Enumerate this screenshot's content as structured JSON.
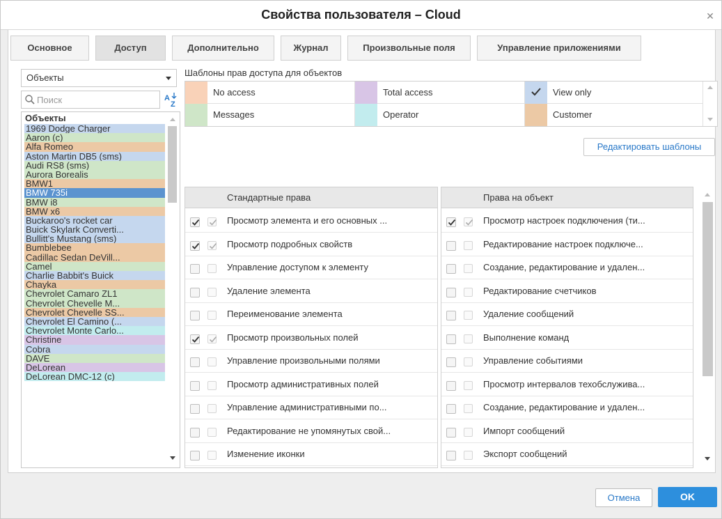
{
  "window": {
    "title": "Свойства пользователя – Cloud"
  },
  "tabs": [
    {
      "label": "Основное",
      "active": false
    },
    {
      "label": "Доступ",
      "active": true
    },
    {
      "label": "Дополнительно",
      "active": false
    },
    {
      "label": "Журнал",
      "active": false
    },
    {
      "label": "Произвольные поля",
      "active": false
    },
    {
      "label": "Управление приложениями",
      "active": false
    }
  ],
  "left_panel": {
    "object_type_select": "Объекты",
    "search_placeholder": "Поиск",
    "list_header": "Объекты",
    "items": [
      {
        "label": "1969 Dodge Charger",
        "color": "#c5d7ee"
      },
      {
        "label": "Aaron (c)",
        "color": "#cfe6c8"
      },
      {
        "label": "Alfa Romeo",
        "color": "#ecc9a5"
      },
      {
        "label": "Aston Martin DB5 (sms)",
        "color": "#c5d7ee"
      },
      {
        "label": "Audi RS8 (sms)",
        "color": "#cfe6c8"
      },
      {
        "label": "Aurora Borealis",
        "color": "#cfe6c8"
      },
      {
        "label": "BMW1",
        "color": "#ecc9a5"
      },
      {
        "label": "BMW 735i",
        "color": "#5b93cf",
        "selected": true
      },
      {
        "label": "BMW i8",
        "color": "#cfe6c8"
      },
      {
        "label": "BMW x6",
        "color": "#ecc9a5"
      },
      {
        "label": "Buckaroo's rocket car",
        "color": "#c5d7ee"
      },
      {
        "label": "Buick Skylark Converti...",
        "color": "#c5d7ee"
      },
      {
        "label": "Bullitt's Mustang (sms)",
        "color": "#c5d7ee"
      },
      {
        "label": "Bumblebee",
        "color": "#ecc9a5"
      },
      {
        "label": "Cadillac Sedan DeVill...",
        "color": "#ecc9a5"
      },
      {
        "label": "Camel",
        "color": "#cfe6c8"
      },
      {
        "label": "Charlie Babbit's Buick",
        "color": "#c5d7ee"
      },
      {
        "label": "Chayka",
        "color": "#ecc9a5"
      },
      {
        "label": "Chevrolet Camaro ZL1",
        "color": "#cfe6c8"
      },
      {
        "label": "Chevrolet Chevelle M...",
        "color": "#cfe6c8"
      },
      {
        "label": "Chevrolet Chevelle SS...",
        "color": "#ecc9a5"
      },
      {
        "label": "Chevrolet El Camino (...",
        "color": "#c5d7ee"
      },
      {
        "label": "Chevrolet Monte Carlo...",
        "color": "#c2ecee"
      },
      {
        "label": "Christine",
        "color": "#d8c5e6"
      },
      {
        "label": "Cobra",
        "color": "#c5d7ee"
      },
      {
        "label": "DAVE",
        "color": "#cfe6c8"
      },
      {
        "label": "DeLorean",
        "color": "#d8c5e6"
      },
      {
        "label": "DeLorean DMC-12 (c)",
        "color": "#c2ecee"
      }
    ]
  },
  "templates": {
    "label": "Шаблоны прав доступа для объектов",
    "items": [
      {
        "name": "No access",
        "color": "#f9d2b8",
        "checked": false
      },
      {
        "name": "Total access",
        "color": "#d8c5e6",
        "checked": false
      },
      {
        "name": "View only",
        "color": "#c5d7ee",
        "checked": true
      },
      {
        "name": "Messages",
        "color": "#cfe6c8",
        "checked": false
      },
      {
        "name": "Operator",
        "color": "#c2ecee",
        "checked": false
      },
      {
        "name": "Customer",
        "color": "#ecc9a5",
        "checked": false
      }
    ],
    "edit_button": "Редактировать шаблоны"
  },
  "standard_rights": {
    "header": "Стандартные права",
    "rows": [
      {
        "label": "Просмотр элемента и его основных ...",
        "checked": true
      },
      {
        "label": "Просмотр подробных свойств",
        "checked": true
      },
      {
        "label": "Управление доступом к элементу",
        "checked": false
      },
      {
        "label": "Удаление элемента",
        "checked": false
      },
      {
        "label": "Переименование элемента",
        "checked": false
      },
      {
        "label": "Просмотр произвольных полей",
        "checked": true
      },
      {
        "label": "Управление произвольными полями",
        "checked": false
      },
      {
        "label": "Просмотр административных полей",
        "checked": false
      },
      {
        "label": "Управление административными по...",
        "checked": false
      },
      {
        "label": "Редактирование не упомянутых свой...",
        "checked": false
      },
      {
        "label": "Изменение иконки",
        "checked": false
      }
    ]
  },
  "object_rights": {
    "header": "Права на объект",
    "rows": [
      {
        "label": "Просмотр настроек подключения (ти...",
        "checked": true
      },
      {
        "label": "Редактирование настроек подключе...",
        "checked": false
      },
      {
        "label": "Создание, редактирование и удален...",
        "checked": false
      },
      {
        "label": "Редактирование счетчиков",
        "checked": false
      },
      {
        "label": "Удаление сообщений",
        "checked": false
      },
      {
        "label": "Выполнение команд",
        "checked": false
      },
      {
        "label": "Управление событиями",
        "checked": false
      },
      {
        "label": "Просмотр интервалов техобслужива...",
        "checked": false
      },
      {
        "label": "Создание, редактирование и удален...",
        "checked": false
      },
      {
        "label": "Импорт сообщений",
        "checked": false
      },
      {
        "label": "Экспорт сообщений",
        "checked": false
      }
    ]
  },
  "footer": {
    "cancel": "Отмена",
    "ok": "OK"
  }
}
